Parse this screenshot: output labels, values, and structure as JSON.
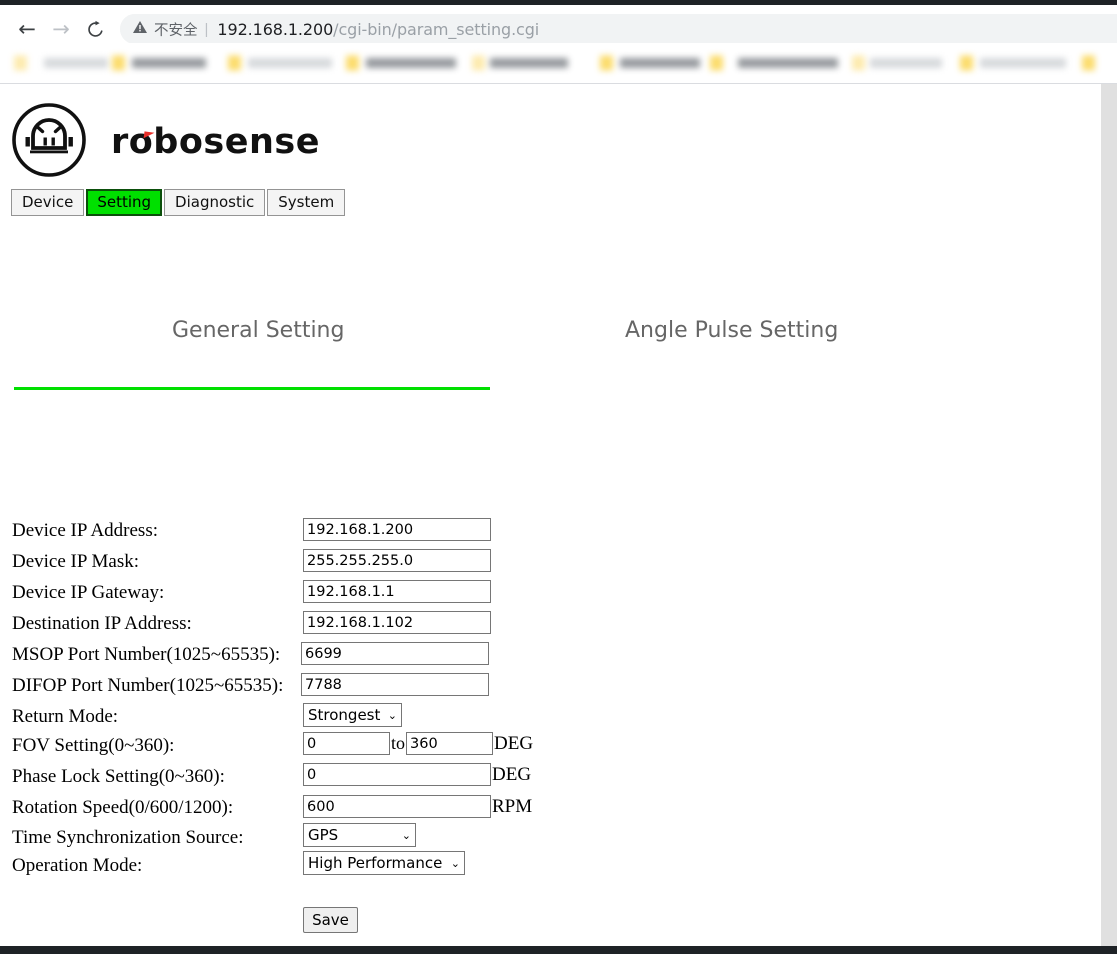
{
  "browser": {
    "back_icon": "back-arrow-icon",
    "forward_icon": "forward-arrow-icon",
    "reload_icon": "reload-icon",
    "warning_icon": "warning-triangle-icon",
    "security_label": "不安全",
    "url_separator": "|",
    "url_host": "192.168.1.200",
    "url_path": "/cgi-bin/param_setting.cgi"
  },
  "brand": {
    "logo_icon": "robosense-robot-logo-icon",
    "wordmark": "robosense",
    "accent_color": "#e8302a"
  },
  "nav_tabs": [
    {
      "label": "Device",
      "active": false
    },
    {
      "label": "Setting",
      "active": true
    },
    {
      "label": "Diagnostic",
      "active": false
    },
    {
      "label": "System",
      "active": false
    }
  ],
  "section_tabs": {
    "general_label": "General Setting",
    "angle_label": "Angle Pulse Setting",
    "active": "General Setting",
    "underline_color": "#00e000"
  },
  "form": {
    "device_ip_address": {
      "label": "Device IP Address:",
      "value": "192.168.1.200"
    },
    "device_ip_mask": {
      "label": "Device IP Mask:",
      "value": "255.255.255.0"
    },
    "device_ip_gateway": {
      "label": "Device IP Gateway:",
      "value": "192.168.1.1"
    },
    "destination_ip_address": {
      "label": "Destination IP Address:",
      "value": "192.168.1.102"
    },
    "msop_port": {
      "label": "MSOP Port Number(1025~65535):",
      "value": "6699"
    },
    "difop_port": {
      "label": "DIFOP Port Number(1025~65535):",
      "value": "7788"
    },
    "return_mode": {
      "label": "Return Mode:",
      "value": "Strongest"
    },
    "fov_setting": {
      "label": "FOV Setting(0~360):",
      "start": "0",
      "joiner": "to",
      "end": "360",
      "unit": "DEG"
    },
    "phase_lock": {
      "label": "Phase Lock Setting(0~360):",
      "value": "0",
      "unit": "DEG"
    },
    "rotation_speed": {
      "label": "Rotation Speed(0/600/1200):",
      "value": "600",
      "unit": "RPM"
    },
    "time_sync_source": {
      "label": "Time Synchronization Source:",
      "value": "GPS"
    },
    "operation_mode": {
      "label": "Operation Mode:",
      "value": "High Performance"
    },
    "save_label": "Save"
  }
}
